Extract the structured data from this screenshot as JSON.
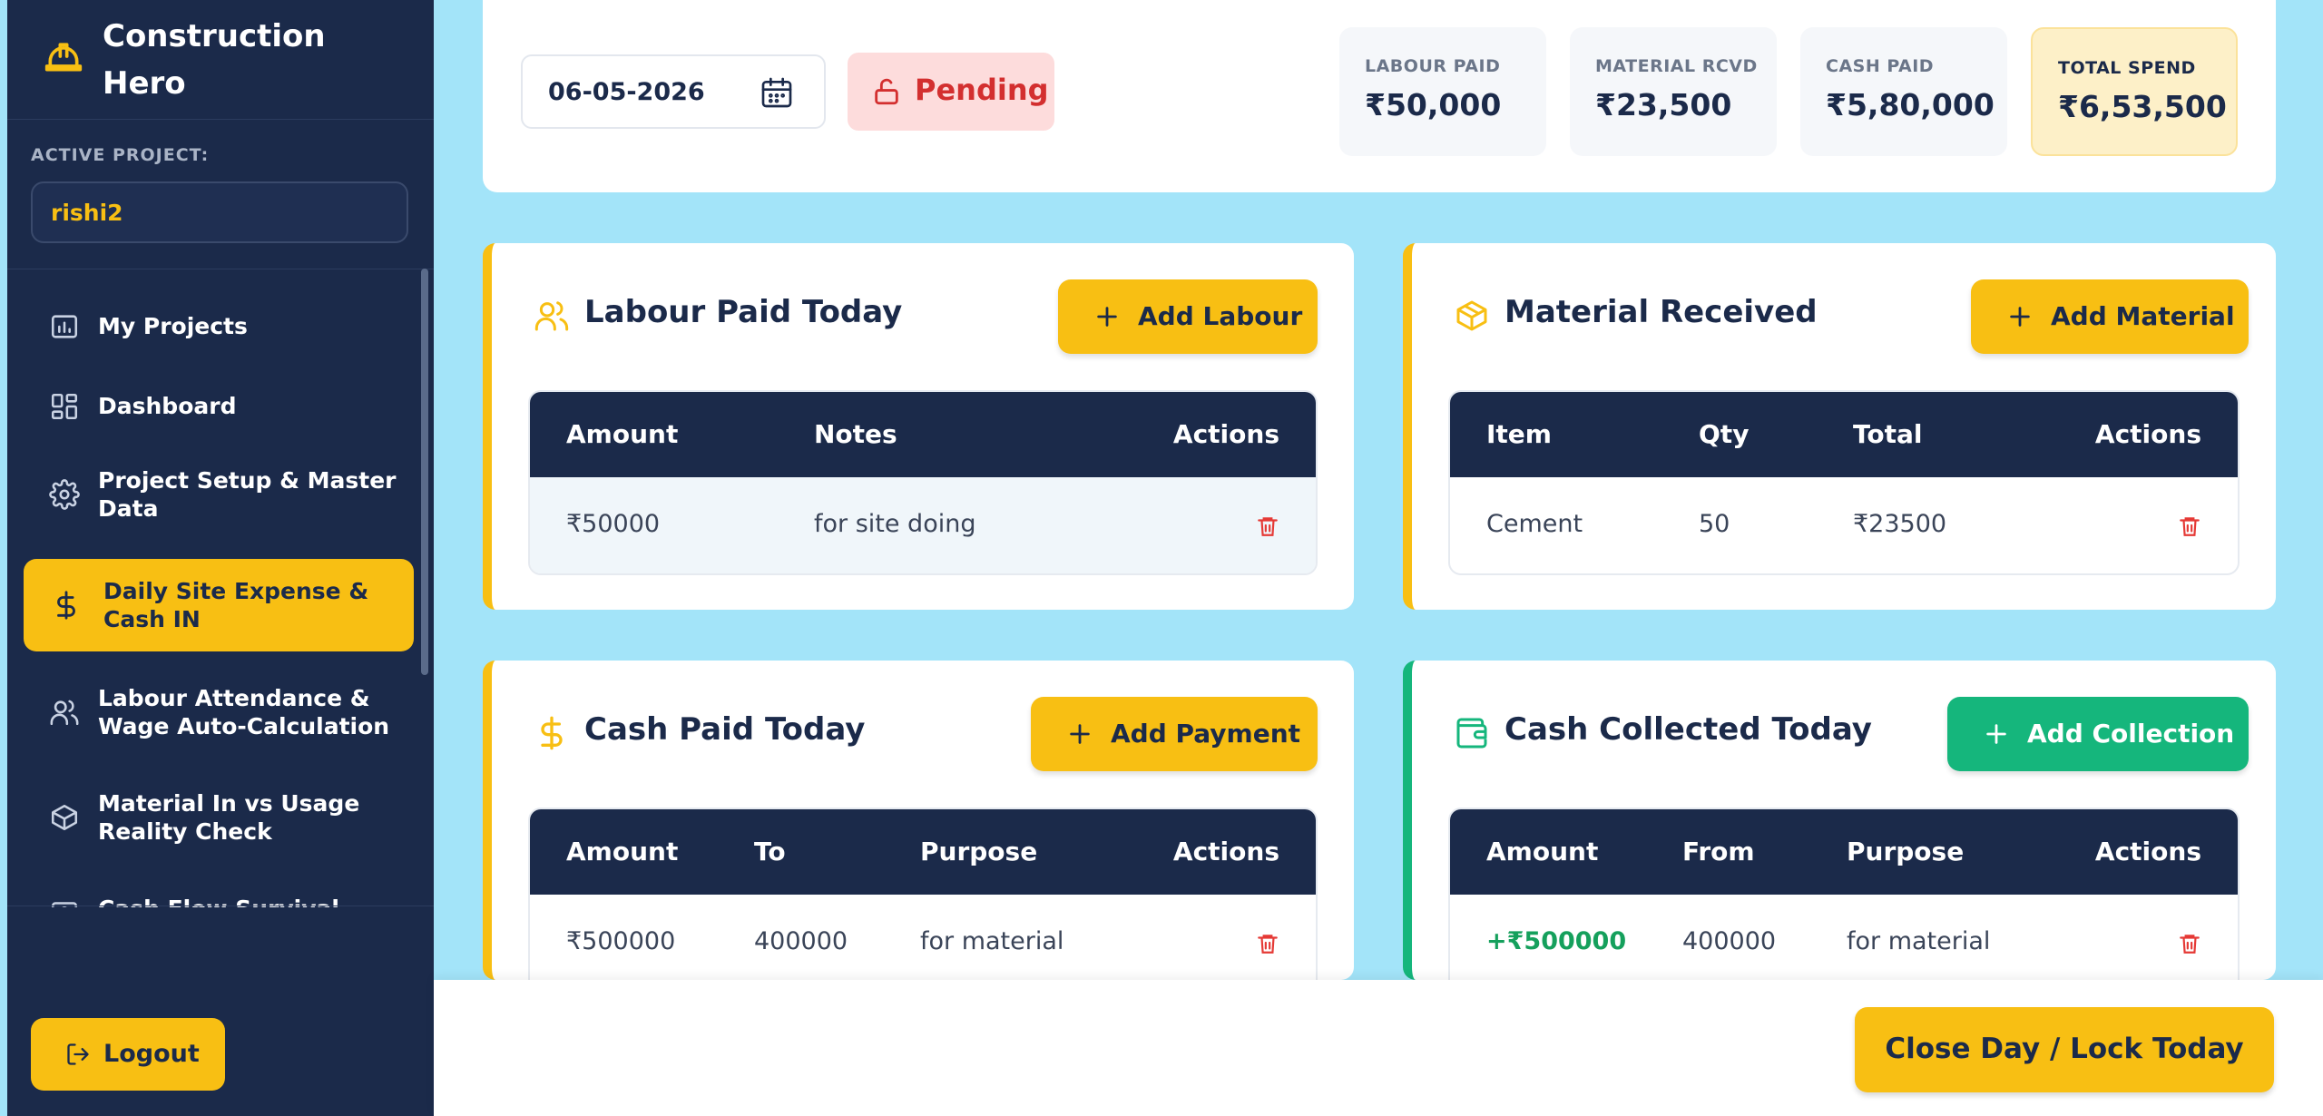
{
  "brand": {
    "name": "Construction Hero",
    "icon": "hard-hat-icon"
  },
  "sidebar": {
    "active_project_label": "ACTIVE PROJECT:",
    "active_project_value": "rishi2",
    "items": [
      {
        "label": "My Projects",
        "icon": "projects-icon"
      },
      {
        "label": "Dashboard",
        "icon": "dashboard-icon"
      },
      {
        "label": "Project Setup & Master Data",
        "icon": "gear-icon"
      },
      {
        "label": "Daily Site Expense & Cash IN",
        "icon": "dollar-icon",
        "active": true
      },
      {
        "label": "Labour Attendance & Wage Auto-Calculation",
        "icon": "users-icon"
      },
      {
        "label": "Material In vs Usage Reality Check",
        "icon": "box-icon"
      },
      {
        "label": "Cash Flow Survival",
        "icon": "cash-flow-icon"
      }
    ],
    "logout_label": "Logout"
  },
  "header": {
    "date": "06-05-2026",
    "status": "Pending",
    "stats": [
      {
        "label": "LABOUR PAID",
        "value": "₹50,000"
      },
      {
        "label": "MATERIAL RCVD",
        "value": "₹23,500"
      },
      {
        "label": "CASH PAID",
        "value": "₹5,80,000"
      },
      {
        "label": "TOTAL SPEND",
        "value": "₹6,53,500"
      }
    ]
  },
  "labour": {
    "title": "Labour Paid Today",
    "add_label": "Add Labour",
    "columns": [
      "Amount",
      "Notes",
      "Actions"
    ],
    "rows": [
      {
        "amount": "₹50000",
        "notes": "for site doing"
      }
    ]
  },
  "material": {
    "title": "Material Received",
    "add_label": "Add Material",
    "columns": [
      "Item",
      "Qty",
      "Total",
      "Actions"
    ],
    "rows": [
      {
        "item": "Cement",
        "qty": "50",
        "total": "₹23500"
      }
    ]
  },
  "cash_paid": {
    "title": "Cash Paid Today",
    "add_label": "Add Payment",
    "columns": [
      "Amount",
      "To",
      "Purpose",
      "Actions"
    ],
    "rows": [
      {
        "amount": "₹500000",
        "to": "400000",
        "purpose": "for material"
      }
    ]
  },
  "cash_collected": {
    "title": "Cash Collected Today",
    "add_label": "Add Collection",
    "columns": [
      "Amount",
      "From",
      "Purpose",
      "Actions"
    ],
    "rows": [
      {
        "amount": "+₹500000",
        "from": "400000",
        "purpose": "for material"
      }
    ]
  },
  "footer": {
    "close_label": "Close Day / Lock Today"
  },
  "colors": {
    "navy": "#1b2a4a",
    "accent": "#f8bf13",
    "green": "#15b67c",
    "danger": "#d32f2f",
    "background": "#a3e4f9"
  }
}
